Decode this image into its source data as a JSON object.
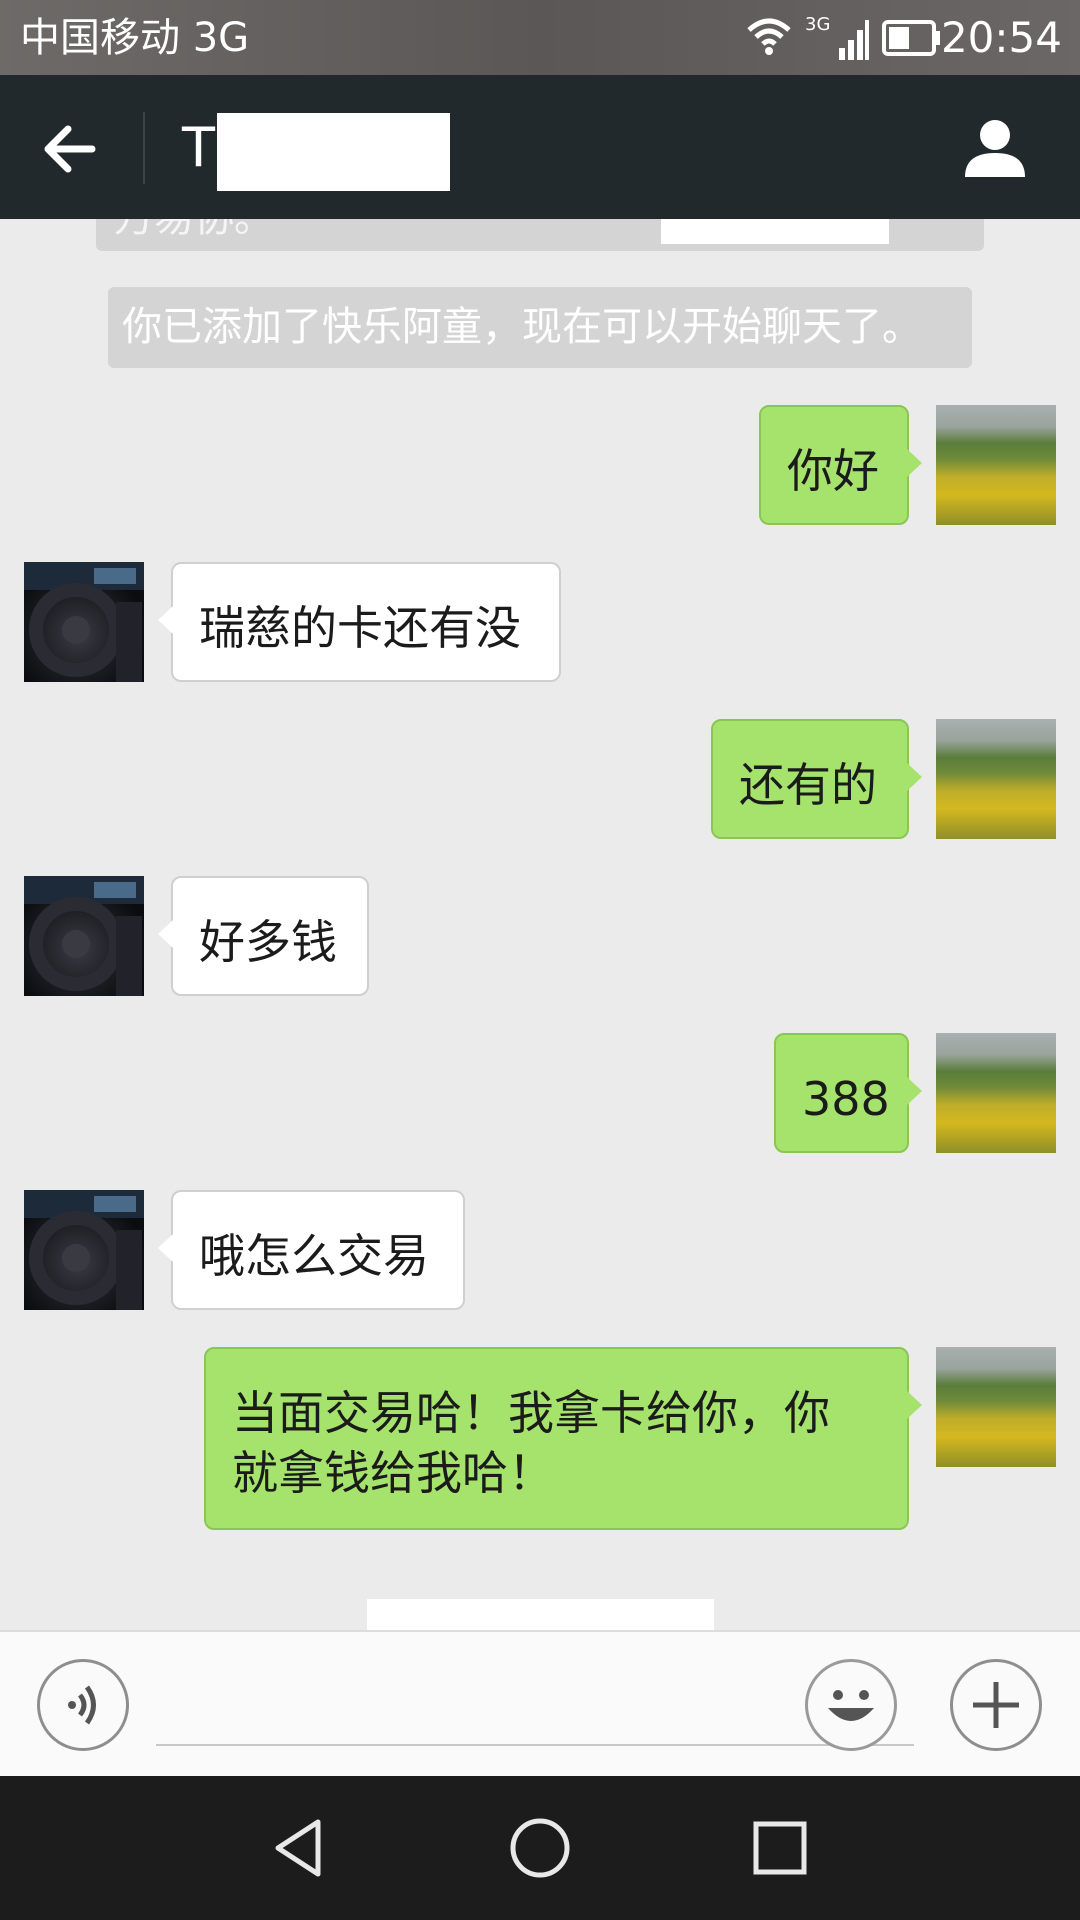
{
  "status_bar": {
    "carrier": "中国移动 3G",
    "network_tag": "3G",
    "time": "20:54"
  },
  "header": {
    "title": "T",
    "back_icon": "arrow-left-icon",
    "profile_icon": "person-icon"
  },
  "chat": {
    "system_messages": [
      {
        "text": "万易协。"
      },
      {
        "text": "你已添加了快乐阿童，现在可以开始聊天了。"
      }
    ],
    "messages": [
      {
        "sender": "me",
        "text": "你好"
      },
      {
        "sender": "other",
        "text": "瑞慈的卡还有没"
      },
      {
        "sender": "me",
        "text": "还有的"
      },
      {
        "sender": "other",
        "text": "好多钱"
      },
      {
        "sender": "me",
        "text": "388"
      },
      {
        "sender": "other",
        "text": "哦怎么交易"
      },
      {
        "sender": "me",
        "lines": [
          "当面交易哈！我拿卡给你，你",
          "就拿钱给我哈！"
        ]
      }
    ]
  },
  "input_bar": {
    "voice_icon": "voice-icon",
    "emoji_icon": "emoji-icon",
    "plus_icon": "plus-icon",
    "placeholder": ""
  },
  "nav_bar": {
    "back_icon": "triangle-back-icon",
    "home_icon": "circle-home-icon",
    "recents_icon": "square-recents-icon"
  },
  "colors": {
    "header_bg": "#22292c",
    "chat_bg": "#ebebeb",
    "my_bubble": "#a6e36d",
    "other_bubble": "#ffffff",
    "system_bubble": "#d4d4d4"
  }
}
